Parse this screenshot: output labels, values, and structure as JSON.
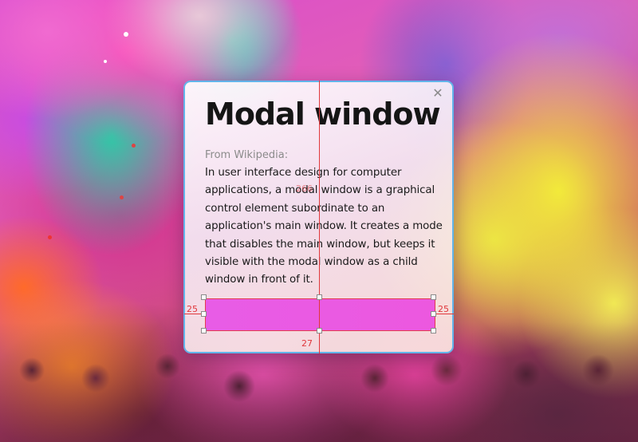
{
  "modal": {
    "close_glyph": "✕",
    "title": "Modal window",
    "source": "From Wikipedia:",
    "body": "In user interface design for computer applications, a modal window is a graphical control element subordinate to an application's main window. It creates a mode that disables the main window, but keeps it visible with the modal window as a child window in front of it."
  },
  "measurements": {
    "left_margin": "25",
    "right_margin": "25",
    "bottom_margin": "27",
    "center_label": "266"
  },
  "colors": {
    "modal_border": "#62b4ea",
    "guide": "#e0383c",
    "action_bar": "#e85ce6"
  }
}
